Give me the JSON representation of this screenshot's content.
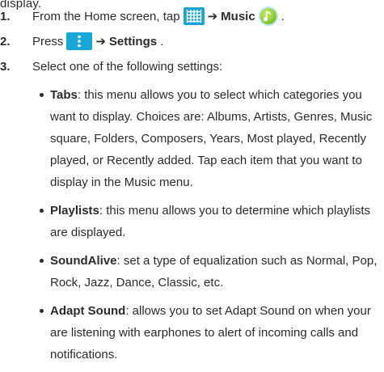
{
  "top_partial_line": "display.",
  "steps": [
    {
      "number": "1.",
      "text_before": "From the Home screen, tap",
      "arrow": "➔",
      "target": "Music",
      "suffix": "."
    },
    {
      "number": "2.",
      "text_before": "Press",
      "arrow": "➔",
      "target": "Settings",
      "suffix": "."
    },
    {
      "number": "3.",
      "text": "Select one of the following settings:"
    }
  ],
  "settings": [
    {
      "term": "Tabs",
      "description": ": this menu allows you to select which categories you want to display. Choices are: Albums, Artists, Genres, Music square, Folders, Composers, Years, Most played, Recently played, or Recently added. Tap each item that you want to display in the Music menu."
    },
    {
      "term": "Playlists",
      "description": ": this menu allows you to determine which playlists are displayed."
    },
    {
      "term": "SoundAlive",
      "description": ": set a type of equalization such as Normal, Pop, Rock, Jazz, Dance, Classic, etc."
    },
    {
      "term": "Adapt Sound",
      "description": ": allows you to set Adapt Sound on when your are listening with earphones to alert of incoming calls and notifications."
    }
  ],
  "icons": {
    "apps": "apps-grid-icon",
    "music": "music-app-icon",
    "menu": "menu-icon"
  },
  "colors": {
    "icon_blue": "#1aa3d9",
    "music_green": "#6fbf1d",
    "text": "#2b2b2b"
  }
}
